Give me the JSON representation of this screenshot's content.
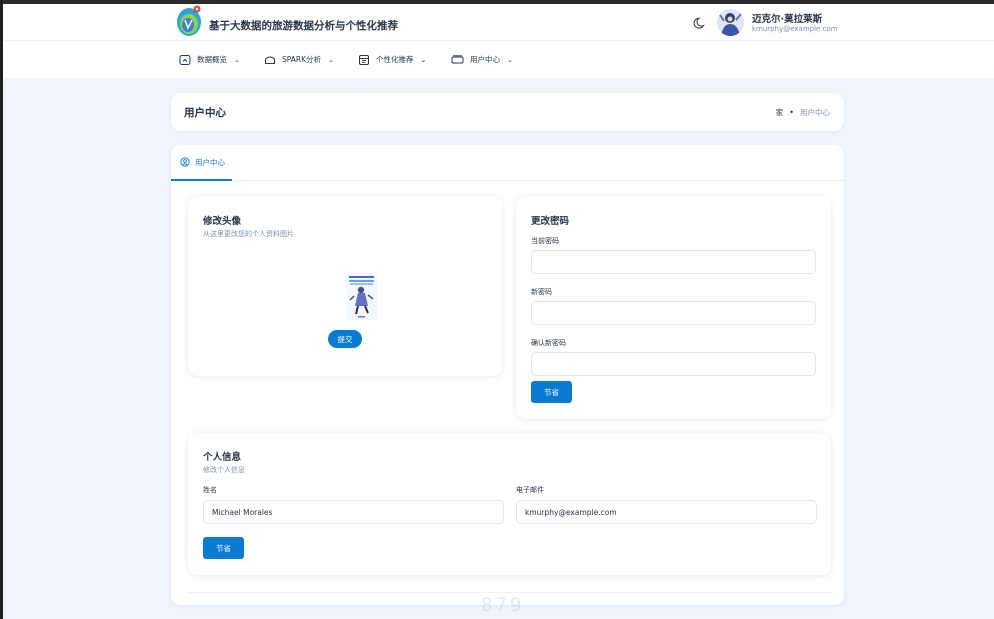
{
  "header": {
    "app_title": "基于大数据的旅游数据分析与个性化推荐",
    "user_name": "迈克尔·莫拉莱斯",
    "user_email": "kmurphy@example.com"
  },
  "nav": {
    "items": [
      {
        "label": "数据概览",
        "icon": "dashboard-icon"
      },
      {
        "label": "SPARK分析",
        "icon": "chart-icon"
      },
      {
        "label": "个性化推荐",
        "icon": "calendar-icon"
      },
      {
        "label": "用户中心",
        "icon": "user-card-icon"
      }
    ]
  },
  "breadcrumb": {
    "title": "用户中心",
    "home": "家",
    "current": "用户中心"
  },
  "tabs": [
    {
      "label": "用户中心",
      "active": true
    }
  ],
  "avatar_card": {
    "title": "修改头像",
    "subtitle": "从这里更改您的个人资料图片",
    "submit_label": "提交"
  },
  "password_card": {
    "title": "更改密码",
    "current_label": "当前密码",
    "new_label": "新密码",
    "confirm_label": "确认新密码",
    "save_label": "节省"
  },
  "profile_card": {
    "title": "个人信息",
    "subtitle": "修改个人信息",
    "name_label": "姓名",
    "name_value": "Michael Morales",
    "email_label": "电子邮件",
    "email_value": "kmurphy@example.com",
    "save_label": "节省"
  },
  "watermark": "879",
  "colors": {
    "primary": "#0b7bd1",
    "background": "#f1f5fb",
    "text": "#2a3547",
    "muted": "#7c8fac"
  }
}
